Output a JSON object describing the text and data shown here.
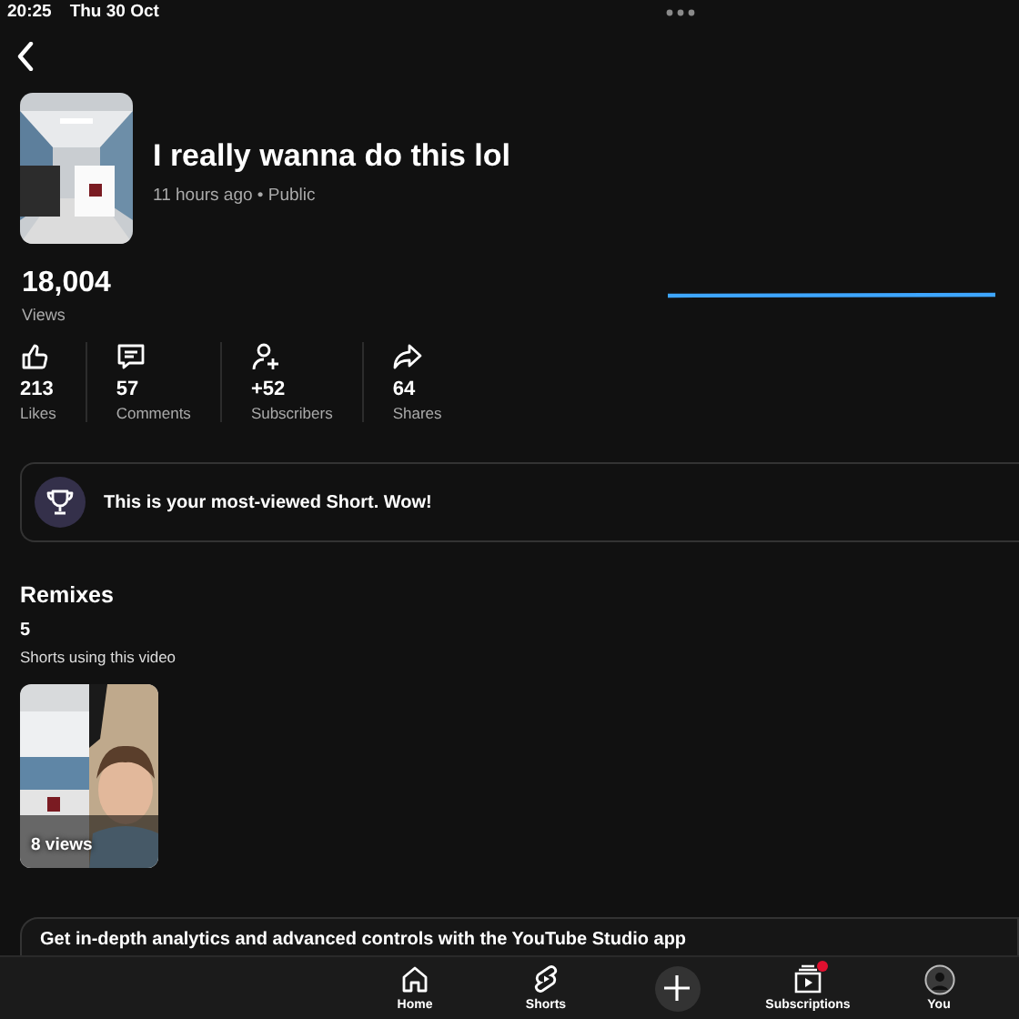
{
  "status_bar": {
    "time": "20:25",
    "date": "Thu 30 Oct"
  },
  "video": {
    "title": "I really wanna do this lol",
    "meta": "11 hours ago • Public",
    "views": "18,004",
    "views_label": "Views"
  },
  "stats": [
    {
      "kind": "likes",
      "value": "213",
      "label": "Likes"
    },
    {
      "kind": "comments",
      "value": "57",
      "label": "Comments"
    },
    {
      "kind": "subscribers",
      "value": "+52",
      "label": "Subscribers"
    },
    {
      "kind": "shares",
      "value": "64",
      "label": "Shares"
    }
  ],
  "achievement": {
    "text": "This is your most-viewed Short. Wow!"
  },
  "remixes": {
    "title": "Remixes",
    "count": "5",
    "subtitle": "Shorts using this video",
    "items": [
      {
        "views": "8 views"
      }
    ]
  },
  "promo": {
    "text": "Get in-depth analytics and advanced controls with the YouTube Studio app"
  },
  "nav": [
    {
      "kind": "home",
      "label": "Home",
      "badge": false
    },
    {
      "kind": "shorts",
      "label": "Shorts",
      "badge": false
    },
    {
      "kind": "create"
    },
    {
      "kind": "subscriptions",
      "label": "Subscriptions",
      "badge": true
    },
    {
      "kind": "you",
      "label": "You",
      "badge": false
    }
  ]
}
